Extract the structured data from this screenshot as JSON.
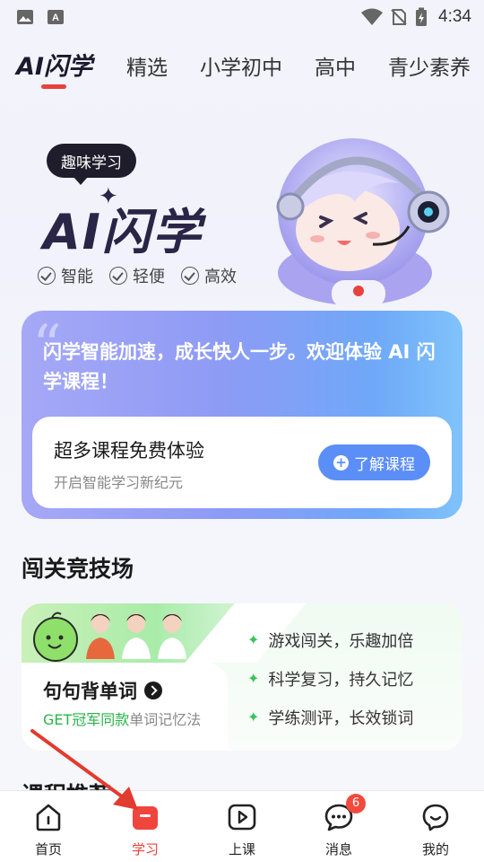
{
  "status_bar": {
    "time": "4:34"
  },
  "top_tabs": [
    {
      "label": "AI闪学",
      "active": true
    },
    {
      "label": "精选",
      "active": false
    },
    {
      "label": "小学初中",
      "active": false
    },
    {
      "label": "高中",
      "active": false
    },
    {
      "label": "青少素养",
      "active": false
    }
  ],
  "hero": {
    "badge": "趣味学习",
    "title": "AI闪学",
    "features": [
      "智能",
      "轻便",
      "高效"
    ]
  },
  "intro_card": {
    "text": "闪学智能加速，成长快人一步。欢迎体验 AI 闪学课程！",
    "inner_title": "超多课程免费体验",
    "inner_subtitle": "开启智能学习新纪元",
    "button_label": "了解课程"
  },
  "arena": {
    "section_title": "闯关竞技场",
    "card_title": "句句背单词",
    "subtitle_highlight": "GET冠军同款",
    "subtitle_rest": "单词记忆法",
    "features": [
      "游戏闯关，乐趣加倍",
      "科学复习，持久记忆",
      "学练测评，长效锁词"
    ]
  },
  "next_section_peek": "课程推荐",
  "bottom_nav": [
    {
      "label": "首页",
      "icon": "home-icon",
      "active": false
    },
    {
      "label": "学习",
      "icon": "study-icon",
      "active": true
    },
    {
      "label": "上课",
      "icon": "play-class-icon",
      "active": false
    },
    {
      "label": "消息",
      "icon": "message-icon",
      "active": false,
      "badge": "6"
    },
    {
      "label": "我的",
      "icon": "profile-icon",
      "active": false
    }
  ],
  "colors": {
    "accent": "#e8423d",
    "button_blue": "#5b8ff7",
    "green": "#27b44a"
  }
}
